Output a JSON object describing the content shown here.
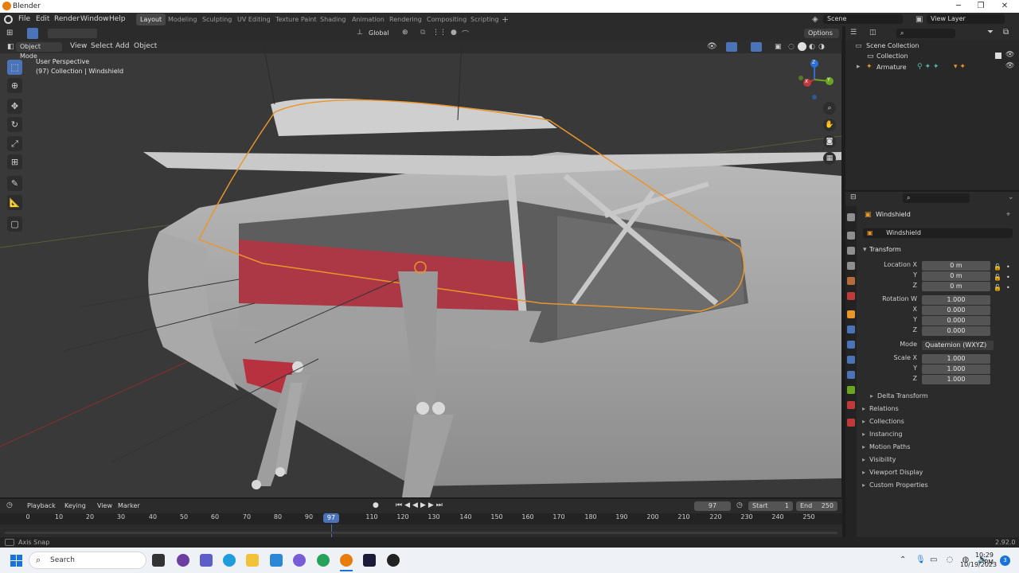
{
  "window": {
    "title": "Blender"
  },
  "menu": {
    "items": [
      "File",
      "Edit",
      "Render",
      "Window",
      "Help"
    ]
  },
  "workspaces": [
    "Layout",
    "Modeling",
    "Sculpting",
    "UV Editing",
    "Texture Paint",
    "Shading",
    "Animation",
    "Rendering",
    "Compositing",
    "Scripting"
  ],
  "active_workspace": "Layout",
  "scene": {
    "label": "Scene",
    "view_layer": "View Layer"
  },
  "viewport": {
    "transform_orientation": "Global",
    "options_label": "Options",
    "mode": "Object Mode",
    "header_menus": [
      "View",
      "Select",
      "Add",
      "Object"
    ],
    "overlay_title": "User Perspective",
    "overlay_subtitle": "(97) Collection | Windshield",
    "gizmo_axes": {
      "x": "X",
      "y": "Y",
      "z": "Z"
    }
  },
  "outliner": {
    "scene_collection": "Scene Collection",
    "collection": "Collection",
    "armature": "Armature"
  },
  "properties": {
    "object_name": "Windshield",
    "data_name": "Windshield",
    "transform_label": "Transform",
    "location": {
      "label": "Location X",
      "x": "0 m",
      "y": "0 m",
      "z": "0 m"
    },
    "rotation": {
      "label": "Rotation W",
      "w": "1.000",
      "x": "0.000",
      "y": "0.000",
      "z": "0.000"
    },
    "mode_label": "Mode",
    "mode_value": "Quaternion (WXYZ)",
    "scale": {
      "label": "Scale X",
      "x": "1.000",
      "y": "1.000",
      "z": "1.000"
    },
    "axis_labels": {
      "y": "Y",
      "z": "Z",
      "x": "X"
    },
    "delta_transform": "Delta Transform",
    "panels": [
      "Relations",
      "Collections",
      "Instancing",
      "Motion Paths",
      "Visibility",
      "Viewport Display",
      "Custom Properties"
    ]
  },
  "timeline": {
    "menus": [
      "Playback",
      "Keying",
      "View",
      "Marker"
    ],
    "current_frame": "97",
    "start_label": "Start",
    "start": "1",
    "end_label": "End",
    "end": "250",
    "ruler_ticks": [
      "0",
      "10",
      "20",
      "30",
      "40",
      "50",
      "60",
      "70",
      "80",
      "90",
      "110",
      "120",
      "130",
      "140",
      "150",
      "160",
      "170",
      "180",
      "190",
      "200",
      "210",
      "220",
      "230",
      "240",
      "250"
    ],
    "playhead_label": "97"
  },
  "status": {
    "hint": "Axis Snap",
    "version": "2.92.0"
  },
  "taskbar": {
    "search_placeholder": "Search",
    "time": "10:29 PM",
    "date": "10/19/2023",
    "notification_count": "3"
  },
  "colors": {
    "accent": "#4a73b8",
    "selection": "#e8962a",
    "seat_red": "#b8313f",
    "ui_dark": "#2b2b2b"
  }
}
